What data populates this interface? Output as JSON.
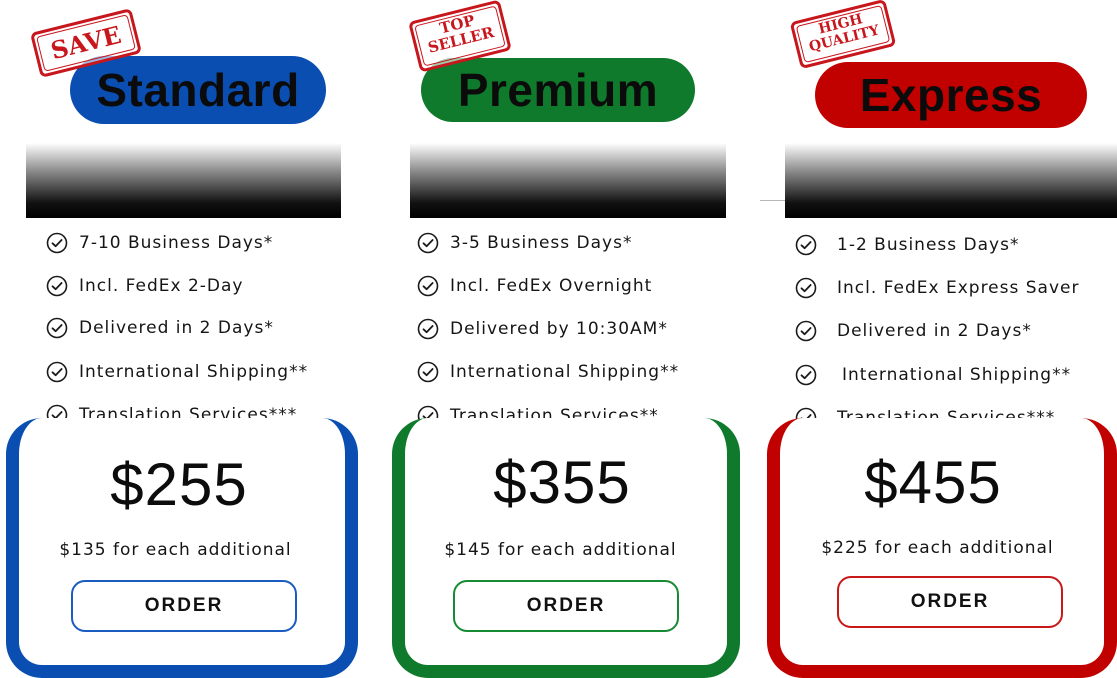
{
  "colors": {
    "standard": "#0a4eb1",
    "premium": "#0f7a2b",
    "express": "#c10000",
    "stamp": "#c8161d"
  },
  "plans": [
    {
      "name": "Standard",
      "stamp": "SAVE",
      "features": [
        "7-10 Business Days*",
        "Incl. FedEx 2-Day",
        "Delivered in 2 Days*",
        "International Shipping**",
        "Translation Services***"
      ],
      "price": "$255",
      "additional": "$135 for each additional",
      "order_label": "ORDER"
    },
    {
      "name": "Premium",
      "stamp": "TOP SELLER",
      "features": [
        "3-5 Business Days*",
        "Incl. FedEx Overnight",
        "Delivered by 10:30AM*",
        "International Shipping**",
        "Translation Services**"
      ],
      "price": "$355",
      "additional": "$145 for each additional",
      "order_label": "ORDER"
    },
    {
      "name": "Express",
      "stamp": "HIGH QUALITY",
      "features": [
        "1-2 Business Days*",
        "Incl. FedEx Express Saver",
        "Delivered in 2 Days*",
        "International Shipping**",
        "Translation Services***"
      ],
      "price": "$455",
      "additional": "$225 for each additional",
      "order_label": "ORDER"
    }
  ],
  "icons": {
    "feature": "check-circle-icon"
  }
}
